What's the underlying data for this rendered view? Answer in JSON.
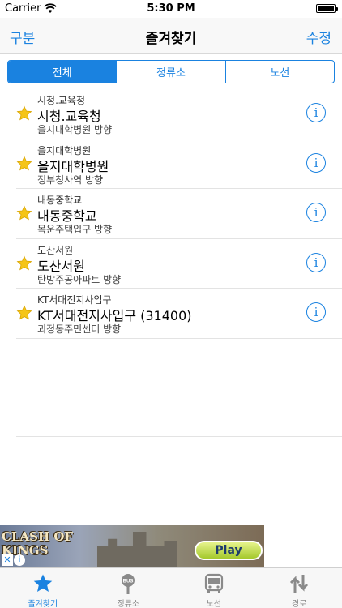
{
  "status_bar": {
    "carrier": "Carrier",
    "time": "5:30 PM"
  },
  "nav": {
    "left": "구분",
    "title": "즐겨찾기",
    "right": "수정"
  },
  "segments": [
    "전체",
    "정류소",
    "노선"
  ],
  "favorites": [
    {
      "sub": "시청.교육청",
      "title": "시청.교육청",
      "desc": "을지대학병원 방향"
    },
    {
      "sub": "을지대학병원",
      "title": "을지대학병원",
      "desc": "정부청사역 방향"
    },
    {
      "sub": "내동중학교",
      "title": "내동중학교",
      "desc": "목운주택입구 방향"
    },
    {
      "sub": "도산서원",
      "title": "도산서원",
      "desc": "탄방주공아파트 방향"
    },
    {
      "sub": "KT서대전지사입구",
      "title": "KT서대전지사입구 (31400)",
      "desc": "괴정동주민센터 방향"
    }
  ],
  "ad": {
    "logo_line1": "CLASH OF",
    "logo_line2": "KINGS",
    "play": "Play"
  },
  "tabs": [
    {
      "label": "즐겨찾기",
      "icon": "star-icon"
    },
    {
      "label": "정류소",
      "icon": "bus-stop-icon"
    },
    {
      "label": "노선",
      "icon": "bus-icon"
    },
    {
      "label": "경로",
      "icon": "route-arrows-icon"
    }
  ],
  "colors": {
    "accent": "#1a82e0",
    "star": "#f5c518"
  }
}
